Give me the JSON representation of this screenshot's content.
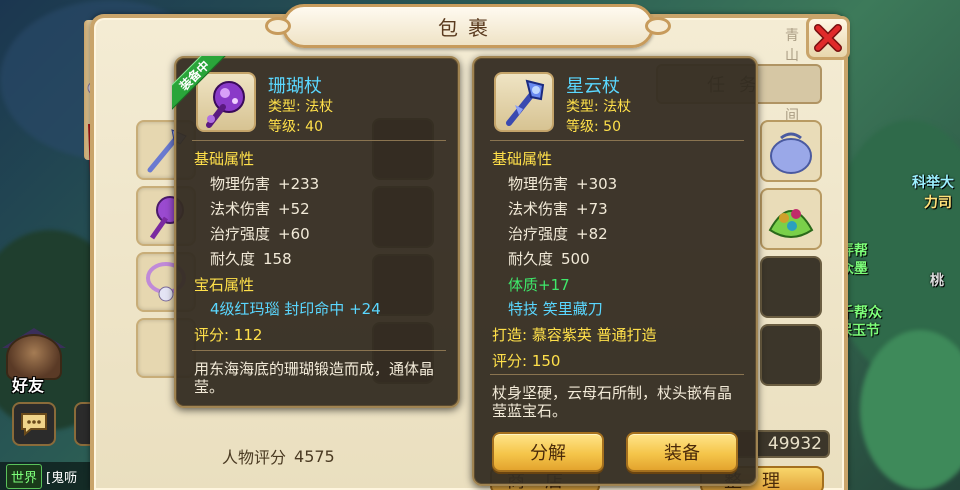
{
  "window": {
    "title": "包裹",
    "title_deco": "青山锦绣间"
  },
  "tabs": {
    "mission": "任务"
  },
  "character": {
    "score_label": "人物评分",
    "score_value": "4575"
  },
  "currency": {
    "value": "49932"
  },
  "bottom_buttons": {
    "left": "商店",
    "right": "整理"
  },
  "hud": {
    "friend_label": "好友",
    "chat_channel": "世界",
    "chat_preview": "[鬼呖",
    "side_names": [
      "科举大",
      "力司",
      "千帮众",
      "保玉节",
      "桃",
      "弄帮",
      "众墨"
    ]
  },
  "equipped_item": {
    "badge": "装备中",
    "name": "珊瑚杖",
    "type": "类型: 法杖",
    "level": "等级: 40",
    "base_section": "基础属性",
    "base_attrs": [
      {
        "k": "物理伤害",
        "v": "+233"
      },
      {
        "k": "法术伤害",
        "v": "+52"
      },
      {
        "k": "治疗强度",
        "v": "+60"
      },
      {
        "k": "耐久度",
        "v": "158"
      }
    ],
    "gem_section": "宝石属性",
    "gem_line": "4级红玛瑙  封印命中  +24",
    "score": "评分: 112",
    "description": "用东海海底的珊瑚锻造而成，通体晶莹。"
  },
  "compare_item": {
    "name": "星云杖",
    "type": "类型: 法杖",
    "level": "等级: 50",
    "base_section": "基础属性",
    "base_attrs": [
      {
        "k": "物理伤害",
        "v": "+303"
      },
      {
        "k": "法术伤害",
        "v": "+73"
      },
      {
        "k": "治疗强度",
        "v": "+82"
      },
      {
        "k": "耐久度",
        "v": "500"
      }
    ],
    "bonus": "体质+17",
    "skill": "特技  笑里藏刀",
    "maker": "打造: 慕容紫英   普通打造",
    "score": "评分: 150",
    "description": "杖身坚硬，云母石所制，杖头嵌有晶莹蓝宝石。",
    "btn_decompose": "分解",
    "btn_equip": "装备"
  },
  "colors": {
    "name": "#5ad7ff",
    "section": "#ffe04a",
    "bonus": "#3fe86a",
    "panel_bg": "#342c22",
    "button": "#f5c54a"
  }
}
